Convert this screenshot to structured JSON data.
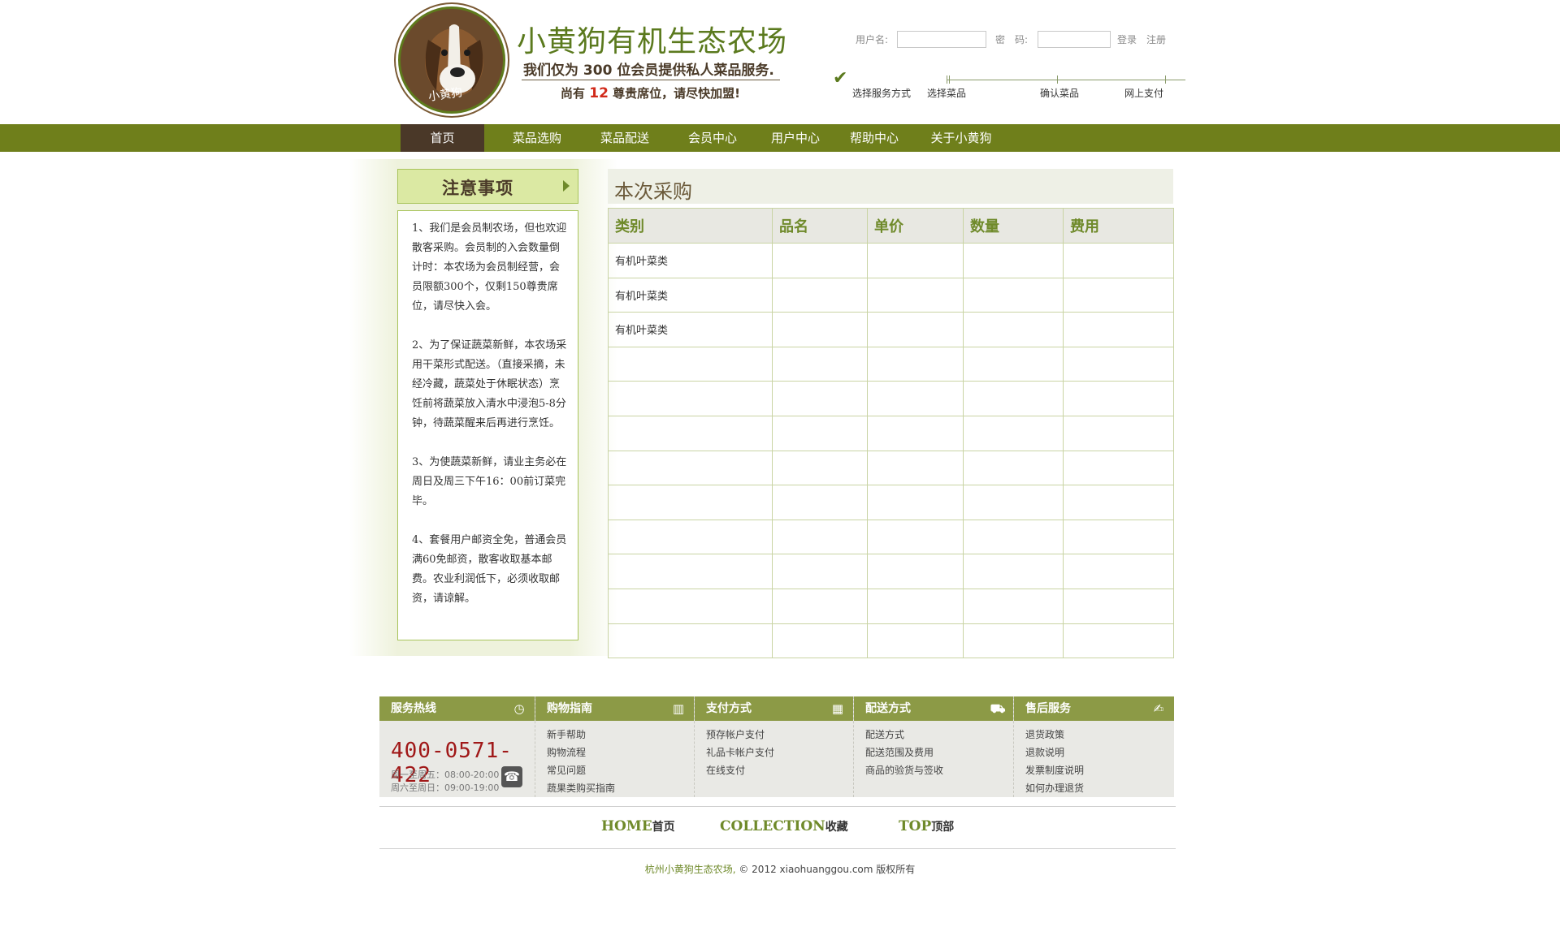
{
  "brand": {
    "logo_text": "小黄狗",
    "title": "小黄狗有机生态农场",
    "subtitle": "我们仅为 300 位会员提供私人菜品服务.",
    "seats_prefix": "尚有",
    "seats_count": "12",
    "seats_suffix": "尊贵席位，请尽快加盟!"
  },
  "login": {
    "username_label": "用户名:",
    "password_label": "密　码:",
    "username_value": "",
    "password_value": "",
    "login_link": "登录",
    "register_link": "注册"
  },
  "steps": [
    "选择服务方式",
    "选择菜品",
    "确认菜品",
    "网上支付"
  ],
  "nav": {
    "items": [
      "首页",
      "菜品选购",
      "菜品配送",
      "会员中心",
      "用户中心",
      "帮助中心",
      "关于小黄狗"
    ],
    "active": "首页"
  },
  "notice": {
    "title": "注意事项",
    "paragraphs": [
      "1、我们是会员制农场，但也欢迎散客采购。会员制的入会数量倒计时：本农场为会员制经营，会员限额300个，仅剩150尊贵席位，请尽快入会。",
      "2、为了保证蔬菜新鲜，本农场采用干菜形式配送。（直接采摘，未经冷藏，蔬菜处于休眠状态）烹饪前将蔬菜放入清水中浸泡5-8分钟，待蔬菜醒来后再进行烹饪。",
      "3、为使蔬菜新鲜，请业主务必在周日及周三下午16：00前订菜完毕。",
      "4、套餐用户邮资全免，普通会员满60免邮资，散客收取基本邮费。农业利润低下，必须收取邮资，请谅解。"
    ]
  },
  "purchase": {
    "title": "本次采购",
    "headers": [
      "类别",
      "品名",
      "单价",
      "数量",
      "费用"
    ],
    "rows": [
      [
        "有机叶菜类",
        "",
        "",
        "",
        ""
      ],
      [
        "有机叶菜类",
        "",
        "",
        "",
        ""
      ],
      [
        "有机叶菜类",
        "",
        "",
        "",
        ""
      ],
      [
        "",
        "",
        "",
        "",
        ""
      ],
      [
        "",
        "",
        "",
        "",
        ""
      ],
      [
        "",
        "",
        "",
        "",
        ""
      ],
      [
        "",
        "",
        "",
        "",
        ""
      ],
      [
        "",
        "",
        "",
        "",
        ""
      ],
      [
        "",
        "",
        "",
        "",
        ""
      ],
      [
        "",
        "",
        "",
        "",
        ""
      ],
      [
        "",
        "",
        "",
        "",
        ""
      ],
      [
        "",
        "",
        "",
        "",
        ""
      ]
    ]
  },
  "footer": {
    "hotline": {
      "title": "服务热线",
      "number": "400-0571-422",
      "hours1": "周一至周五：08:00-20:00",
      "hours2": "周六至周日：09:00-19:00"
    },
    "columns": [
      {
        "title": "购物指南",
        "icon": "book-icon",
        "links": [
          "新手帮助",
          "购物流程",
          "常见问题",
          "蔬果类购买指南"
        ]
      },
      {
        "title": "支付方式",
        "icon": "calendar-icon",
        "links": [
          "预存帐户支付",
          "礼品卡帐户支付",
          "在线支付"
        ]
      },
      {
        "title": "配送方式",
        "icon": "truck-icon",
        "links": [
          "配送方式",
          "配送范围及费用",
          "商品的验货与签收"
        ]
      },
      {
        "title": "售后服务",
        "icon": "service-icon",
        "links": [
          "退货政策",
          "退款说明",
          "发票制度说明",
          "如何办理退货"
        ]
      }
    ],
    "bottom_links": [
      {
        "en": "HOME",
        "cn": "首页"
      },
      {
        "en": "COLLECTION",
        "cn": "收藏"
      },
      {
        "en": "TOP",
        "cn": "顶部"
      }
    ],
    "copyright_company": "杭州小黄狗生态农场,",
    "copyright_rest": "© 2012 xiaohuanggou.com 版权所有"
  },
  "colors": {
    "brand_green": "#6f7f1b",
    "nav_active": "#4a3828",
    "accent_red": "#d12a1a",
    "footer_head": "#8c9a46"
  }
}
